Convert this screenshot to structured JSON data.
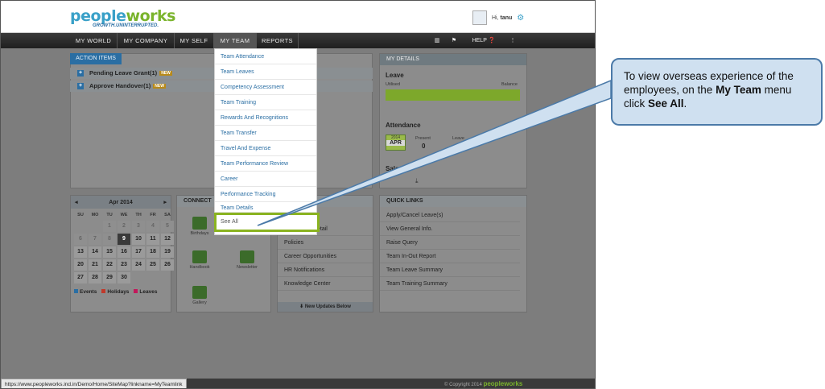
{
  "brand": {
    "name_part1": "people",
    "name_part2": "works",
    "tagline": "GROWTH.UNINTERRUPTED."
  },
  "user": {
    "greeting": "Hi,",
    "name": "tanu"
  },
  "nav": {
    "items": [
      {
        "label": "MY WORLD"
      },
      {
        "label": "MY COMPANY"
      },
      {
        "label": "MY SELF"
      },
      {
        "label": "MY TEAM"
      },
      {
        "label": "REPORTS"
      }
    ],
    "help": "HELP"
  },
  "action_items": {
    "tab": "ACTION ITEMS",
    "rows": [
      {
        "label": "Pending Leave Grant(1)"
      },
      {
        "label": "Approve Handover(1)"
      }
    ],
    "badge": "NEW"
  },
  "my_team_menu": [
    "Team Attendance",
    "Team Leaves",
    "Competency Assessment",
    "Team Training",
    "Rewards And Recognitions",
    "Team Transfer",
    "Travel And Expense",
    "Team Performance Review",
    "Career",
    "Performance Tracking",
    "Team Details",
    "See All"
  ],
  "my_details": {
    "title": "MY DETAILS",
    "leave": {
      "title": "Leave",
      "utilised": "Utilised",
      "balance": "Balance"
    },
    "attendance": {
      "title": "Attendance",
      "year": "2014",
      "month": "APR",
      "present_label": "Present",
      "present_value": "0",
      "leave_label": "Leave",
      "leave_value": "0",
      "leave_short": "Leav"
    },
    "salary": {
      "title": "Salary"
    }
  },
  "calendar": {
    "month": "Apr 2014",
    "prev": "◂",
    "next": "▸",
    "dow": [
      "SU",
      "MO",
      "TU",
      "WE",
      "TH",
      "FR",
      "SA"
    ],
    "days": [
      "",
      "",
      "1",
      "2",
      "3",
      "4",
      "5",
      "6",
      "7",
      "8",
      "9",
      "10",
      "11",
      "12",
      "13",
      "14",
      "15",
      "16",
      "17",
      "18",
      "19",
      "20",
      "21",
      "22",
      "23",
      "24",
      "25",
      "26",
      "27",
      "28",
      "29",
      "30"
    ],
    "legend": {
      "events": "Events",
      "holidays": "Holidays",
      "leaves": "Leaves"
    }
  },
  "connect": {
    "title": "CONNECT",
    "tiles": [
      {
        "label": "Birthdays"
      },
      {
        "label": "Directory"
      },
      {
        "label": "Handbook"
      },
      {
        "label": "Newsletter"
      },
      {
        "label": "Gallery"
      }
    ]
  },
  "info_links": {
    "partial": "etail",
    "items": [
      "Policies",
      "Career Opportunities",
      "HR Notifications",
      "Knowledge Center"
    ],
    "footer": "New Updates Below"
  },
  "quick_links": {
    "title": "QUICK LINKS",
    "items": [
      "Apply/Cancel Leave(s)",
      "View General Info.",
      "Raise Query",
      "Team In-Out Report",
      "Team Leave Summary",
      "Team Training Summary"
    ]
  },
  "callout": {
    "text_1": "To view overseas experience  of the employees, on the ",
    "bold_1": "My  Team",
    "text_2": " menu click ",
    "bold_2": "See All",
    "text_3": "."
  },
  "status": {
    "url": "https://www.peopleworks.ind.in/Demo/Home/SiteMap?linkname=MyTeamlink",
    "copyright": "© Copyright 2014"
  }
}
